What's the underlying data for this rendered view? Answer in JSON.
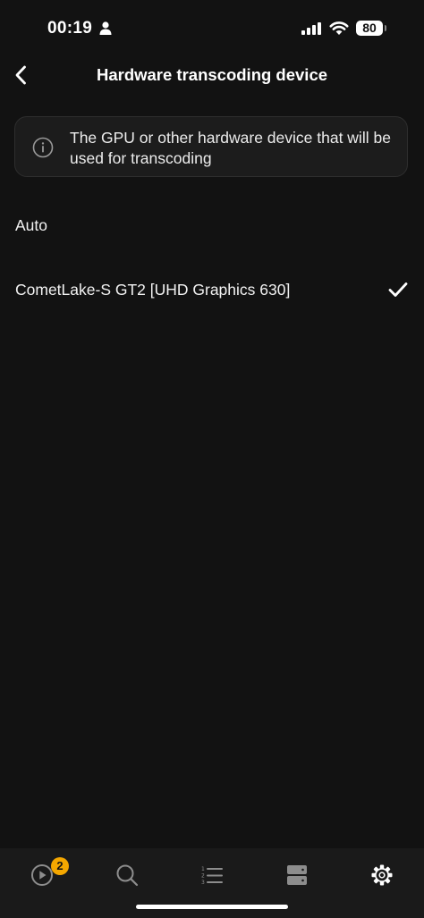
{
  "status_bar": {
    "time": "00:19",
    "battery": "80"
  },
  "nav": {
    "title": "Hardware transcoding device"
  },
  "info": {
    "text": "The GPU or other hardware device that will be used for transcoding"
  },
  "options": [
    {
      "label": "Auto",
      "selected": false
    },
    {
      "label": "CometLake-S GT2 [UHD Graphics 630]",
      "selected": true
    }
  ],
  "tabbar": {
    "tabs": [
      {
        "icon": "play-circle-icon",
        "active": false
      },
      {
        "icon": "search-icon",
        "active": false
      },
      {
        "icon": "numbered-list-icon",
        "active": false
      },
      {
        "icon": "server-icon",
        "active": false
      },
      {
        "icon": "gear-icon",
        "active": true
      }
    ],
    "badge": "2"
  }
}
